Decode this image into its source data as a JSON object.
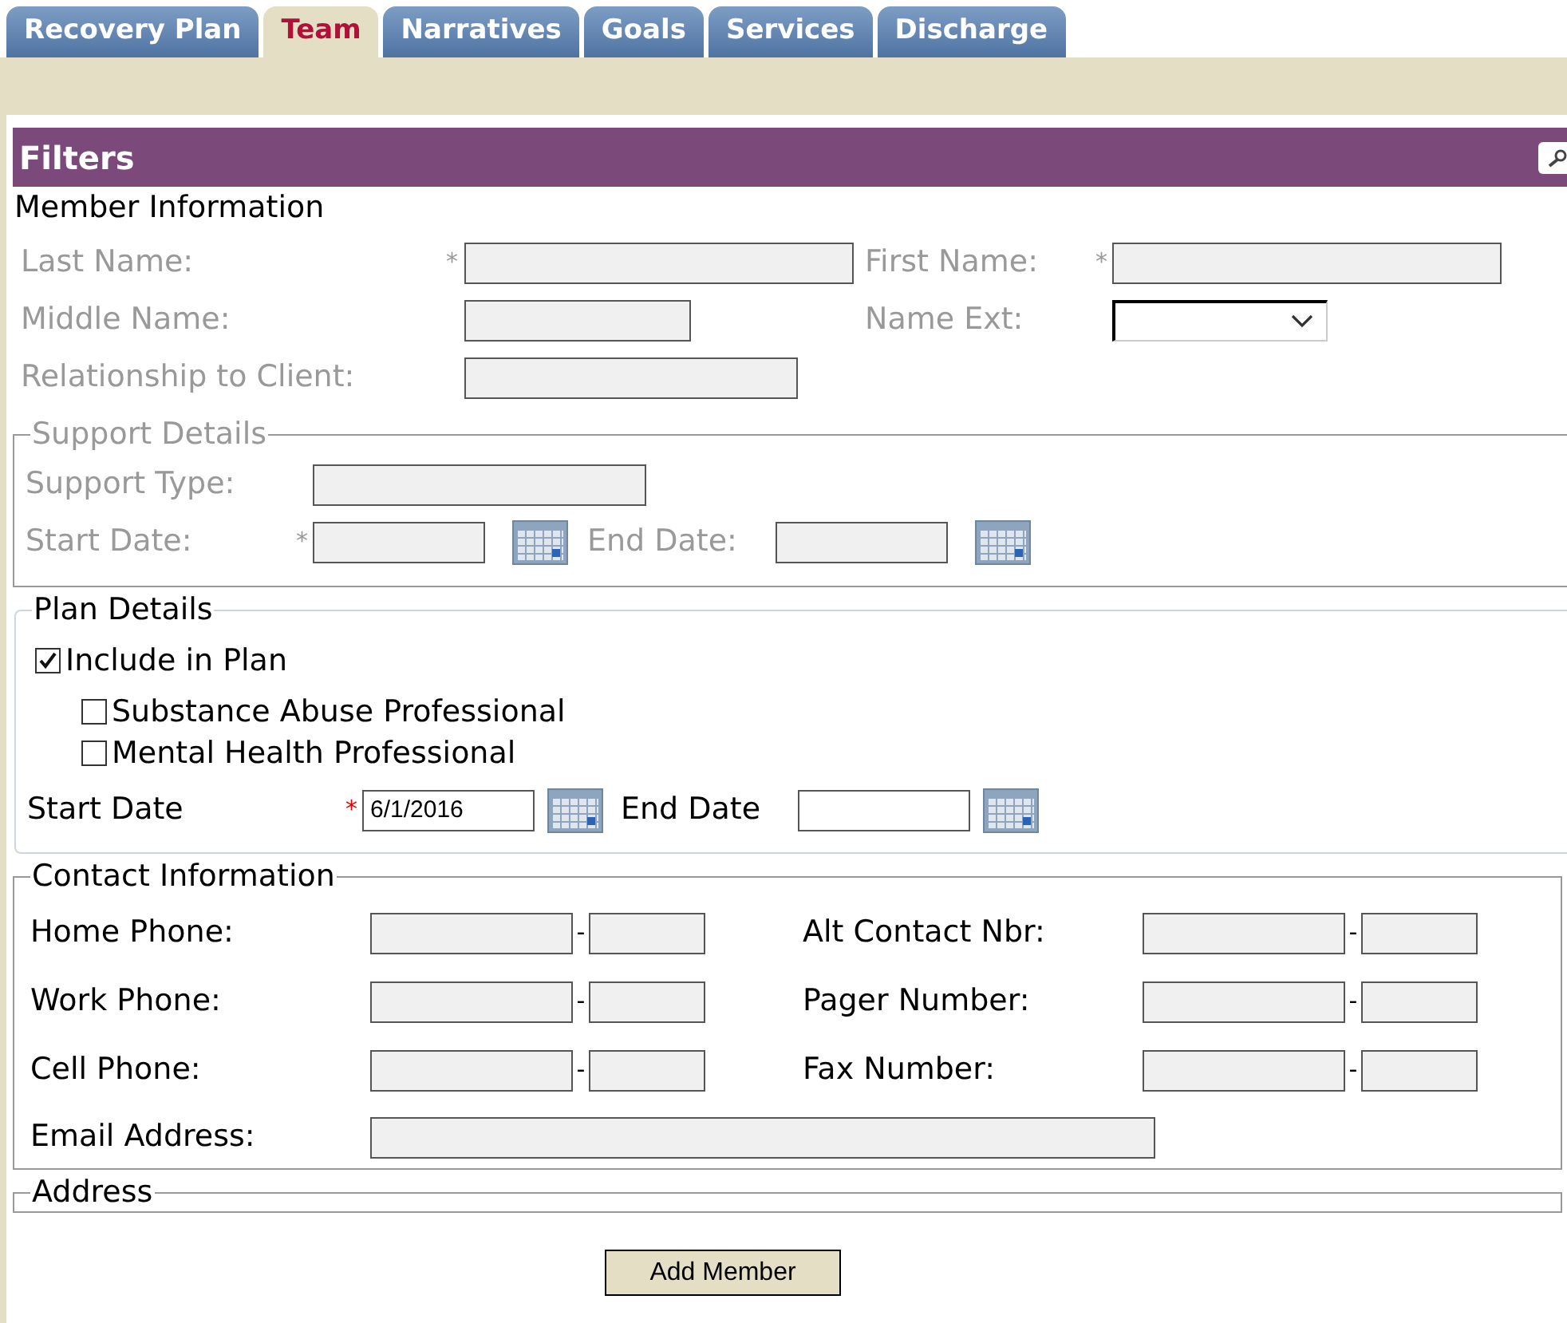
{
  "tabs": [
    {
      "label": "Recovery Plan",
      "selected": false
    },
    {
      "label": "Team",
      "selected": true
    },
    {
      "label": "Narratives",
      "selected": false
    },
    {
      "label": "Goals",
      "selected": false
    },
    {
      "label": "Services",
      "selected": false
    },
    {
      "label": "Discharge",
      "selected": false
    }
  ],
  "filters": {
    "title": "Filters"
  },
  "member_information": {
    "heading": "Member Information",
    "fields": [
      {
        "label": "Last Name:",
        "marker": "*",
        "kind": "text",
        "disabled": true
      },
      {
        "label": "First Name:",
        "marker": "*",
        "kind": "text",
        "disabled": true
      },
      {
        "label": "Middle Name:",
        "kind": "text",
        "disabled": true
      },
      {
        "label": "Name Ext:",
        "kind": "select",
        "disabled": true
      },
      {
        "label": "Relationship to Client:",
        "kind": "text",
        "disabled": true
      }
    ]
  },
  "support_details": {
    "legend": "Support Details",
    "fields": [
      {
        "label": "Support Type:",
        "kind": "text",
        "disabled": true
      },
      {
        "label": "Start Date:",
        "marker": "*",
        "kind": "date",
        "disabled": true
      },
      {
        "label": "End Date:",
        "kind": "date",
        "disabled": true
      }
    ]
  },
  "plan_details": {
    "legend": "Plan Details",
    "include": {
      "label": "Include in Plan",
      "checked": true
    },
    "options": [
      {
        "label": "Substance Abuse Professional",
        "checked": false
      },
      {
        "label": "Mental Health Professional",
        "checked": false
      }
    ],
    "start_date": {
      "label": "Start Date",
      "marker": "*",
      "value": "6/1/2016"
    },
    "end_date": {
      "label": "End Date"
    }
  },
  "contact_information": {
    "legend": "Contact Information",
    "phones": [
      {
        "label": "Home Phone:",
        "separator": "-"
      },
      {
        "label": "Alt Contact Nbr:",
        "separator": "-"
      },
      {
        "label": "Work Phone:",
        "separator": "-"
      },
      {
        "label": "Pager Number:",
        "separator": "-"
      },
      {
        "label": "Cell Phone:",
        "separator": "-"
      },
      {
        "label": "Fax Number:",
        "separator": "-"
      }
    ],
    "email": {
      "label": "Email Address:"
    }
  },
  "address": {
    "legend": "Address"
  },
  "add_button": "Add Member"
}
